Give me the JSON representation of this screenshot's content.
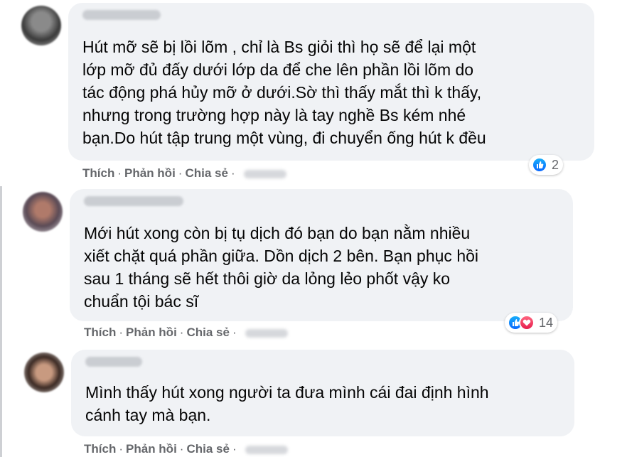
{
  "comments": [
    {
      "author": "",
      "text": "Hút mỡ sẽ bị lồi lõm , chỉ là Bs giỏi thì họ sẽ để lại một\nlớp mỡ đủ đấy dưới lớp da để che lên phần lồi lõm do\ntác động phá hủy mỡ ở dưới.Sờ thì thấy mắt thì k thấy,\nnhưng trong trường hợp này là tay nghề Bs kém nhé\nbạn.Do hút tập trung một vùng, đi chuyển ống hút k đều",
      "actions": {
        "like": "Thích",
        "reply": "Phản hồi",
        "share": "Chia sẻ"
      },
      "reaction_count": "2",
      "reactions": [
        "like-icon"
      ]
    },
    {
      "author": "",
      "text": "Mới hút xong còn bị tụ dịch đó bạn do bạn nằm nhiều\nxiết chặt quá phần giữa. Dồn dịch 2 bên. Bạn phục hồi\nsau 1 tháng sẽ hết thôi giờ da lỏng lẻo phốt vậy ko\nchuẩn tội bác sĩ",
      "actions": {
        "like": "Thích",
        "reply": "Phản hồi",
        "share": "Chia sẻ"
      },
      "reaction_count": "14",
      "reactions": [
        "like-icon",
        "love-icon"
      ]
    },
    {
      "author": "",
      "text": "Mình thấy hút xong người ta đưa mình cái đai định hình\ncánh tay mà bạn.",
      "actions": {
        "like": "Thích",
        "reply": "Phản hồi",
        "share": "Chia sẻ"
      },
      "reaction_count": "",
      "reactions": []
    }
  ],
  "colors": {
    "bubble": "#f0f2f5",
    "action_text": "#65676b",
    "like": "#0866ff",
    "love": "#e61e4d"
  }
}
